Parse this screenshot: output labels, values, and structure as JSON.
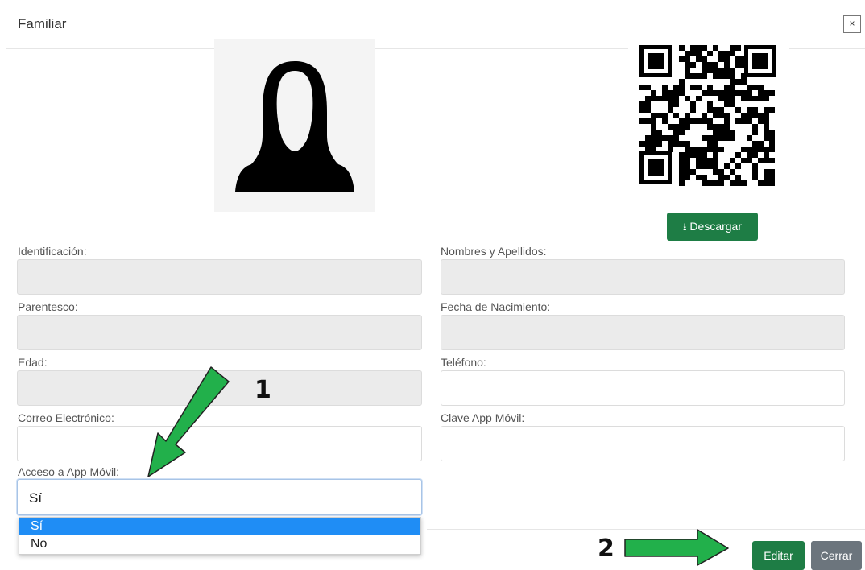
{
  "modal": {
    "title": "Familiar",
    "close_symbol": "×",
    "download_label": "Descargar",
    "download_icon": "download-icon"
  },
  "fields": {
    "identificacion": {
      "label": "Identificación:",
      "value": ""
    },
    "nombres": {
      "label": "Nombres y Apellidos:",
      "value": ""
    },
    "parentesco": {
      "label": "Parentesco:",
      "value": ""
    },
    "fecha_nacimiento": {
      "label": "Fecha de Nacimiento:",
      "value": ""
    },
    "edad": {
      "label": "Edad:",
      "value": ""
    },
    "telefono": {
      "label": "Teléfono:",
      "value": ""
    },
    "correo": {
      "label": "Correo Electrónico:",
      "value": ""
    },
    "clave": {
      "label": "Clave App Móvil:",
      "value": ""
    },
    "acceso": {
      "label": "Acceso a App Móvil:",
      "value": "Sí",
      "options": [
        "Sí",
        "No"
      ],
      "selected": "Sí"
    }
  },
  "footer": {
    "edit_label": "Editar",
    "close_label": "Cerrar"
  },
  "annotations": {
    "arrow1_number": "1",
    "arrow2_number": "2",
    "arrow_color": "#22b04b"
  },
  "colors": {
    "primary_green": "#1e7d45",
    "secondary_gray": "#6c757d",
    "highlight_blue": "#1f8df5"
  }
}
